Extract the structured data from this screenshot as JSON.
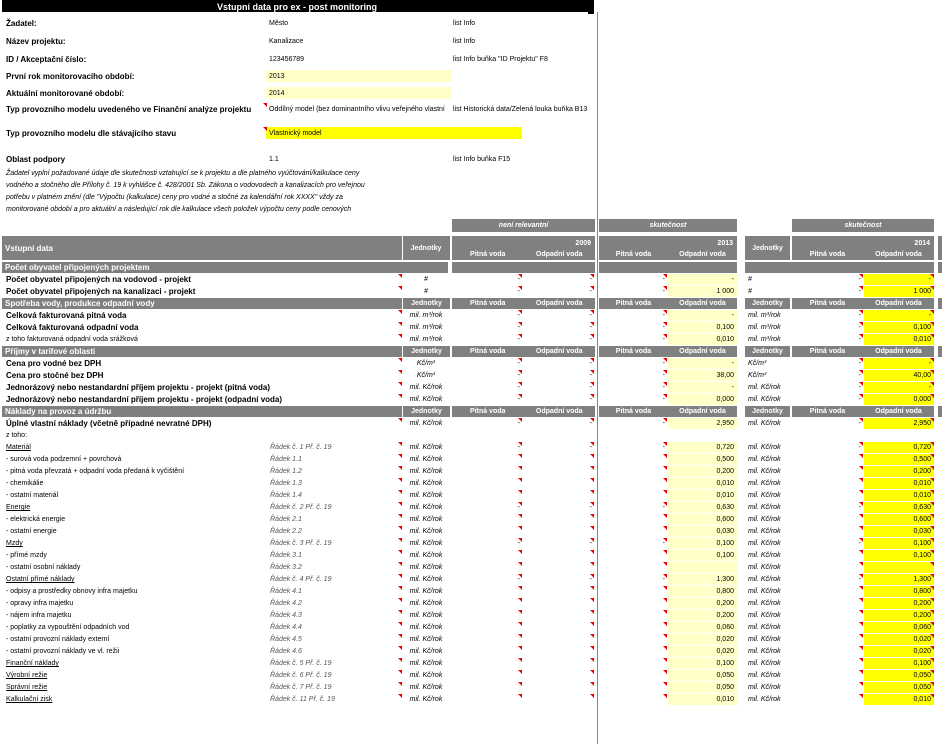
{
  "title": "Vstupní data pro ex - post monitoring",
  "info": [
    {
      "label": "Žadatel:",
      "value": "Město",
      "note": "list Info"
    },
    {
      "label": "Název projektu:",
      "value": "Kanalizace",
      "note": "list Info"
    },
    {
      "label": "ID / Akceptační číslo:",
      "value": "123456789",
      "note": "list Info buňka \"ID Projektu\" F8"
    },
    {
      "label": "První rok monitorovacího období:",
      "value": "2013",
      "note": ""
    },
    {
      "label": "Aktuální monitorované období:",
      "value": "2014",
      "note": ""
    },
    {
      "label": "Typ provozního modelu uvedeného ve Finanční analýze projektu",
      "value": "Oddílný model (bez dominantního vlivu veřejného vlastní",
      "note": "list Historická data/Zelená louka buňka B13"
    },
    {
      "label": "Typ provozního modelu dle stávajícího stavu",
      "value": "Vlastnický model",
      "note": ""
    },
    {
      "label": "Oblast podpory",
      "value": "1.1",
      "note": "list Info buňka F15"
    }
  ],
  "instruction": [
    "Žadatel vyplní požadované údaje dle skutečnosti vztahující se k projektu a dle platného vyúčtování/kalkulace ceny",
    "vodného a stočného dle Přílohy č. 19 k vyhlášce č. 428/2001 Sb. Zákona o vodovodech a kanalizacích pro veřejnou",
    "potřebu v platném znění (dle \"Výpočtu (kalkulace) ceny pro vodné a stočné za kalendářní rok XXXX\" vždy za",
    "monitorované období a pro aktuální a následující rok dle kalkulace všech položek výpočtu ceny podle cenových"
  ],
  "col_hdr": {
    "not_relevant": "není relevantní",
    "reality1": "skutečnost",
    "reality2": "skutečnost",
    "y1": "2009",
    "y2": "2013",
    "y3": "2014",
    "vstupni": "Vstupní data",
    "jednotky": "Jednotky",
    "pitna": "Pitná voda",
    "odpadni": "Odpadní voda"
  },
  "rows": [
    {
      "t": "sec",
      "label": "Počet obyvatel připojených projektem"
    },
    {
      "label": "Počet obyvatel připojených na vodovod - projekt",
      "b": 1,
      "unit": "#",
      "c": [
        "-",
        "-",
        "-",
        "-",
        "-",
        "-"
      ]
    },
    {
      "label": "Počet obyvatel připojených na kanalizaci - projekt",
      "b": 1,
      "unit": "#",
      "c": [
        "-",
        "-",
        "-",
        "1 000",
        "-",
        "1 000"
      ]
    },
    {
      "t": "sec",
      "label": "Spotřeba vody, produkce odpadní vody",
      "hdr": 1
    },
    {
      "label": "Celková fakturovaná pitná voda",
      "b": 1,
      "unit": "mil. m³/rok",
      "c": [
        "-",
        "-",
        "-",
        "-",
        "-",
        "-"
      ]
    },
    {
      "label": "Celková fakturovaná odpadní voda",
      "b": 1,
      "unit": "mil. m³/rok",
      "c": [
        "-",
        "-",
        "-",
        "0,100",
        "-",
        "0,100"
      ]
    },
    {
      "label": "z toho fakturovaná odpadní voda srážková",
      "unit": "mil. m³/rok",
      "c": [
        "-",
        "-",
        "-",
        "0,010",
        "-",
        "0,010"
      ]
    },
    {
      "t": "sec",
      "label": "Příjmy v tarifové oblasti",
      "hdr": 1
    },
    {
      "label": "Cena pro vodné bez DPH",
      "b": 1,
      "unit": "Kč/m³",
      "c": [
        "-",
        "-",
        "-",
        "-",
        "-",
        "-"
      ]
    },
    {
      "label": "Cena pro stočné bez DPH",
      "b": 1,
      "unit": "Kč/m³",
      "c": [
        "-",
        "-",
        "-",
        "38,00",
        "-",
        "40,00"
      ]
    },
    {
      "label": "Jednorázový nebo nestandardní příjem projektu - projekt (pitná voda)",
      "b": 1,
      "unit": "mil. Kč/rok",
      "c": [
        "-",
        "-",
        "-",
        "-",
        "-",
        "-"
      ]
    },
    {
      "label": "Jednorázový nebo nestandardní příjem projektu - projekt (odpadní voda)",
      "b": 1,
      "unit": "mil. Kč/rok",
      "c": [
        "-",
        "-",
        "-",
        "0,000",
        "-",
        "0,000"
      ]
    },
    {
      "t": "sec",
      "label": "Náklady na provoz a údržbu",
      "hdr": 1
    },
    {
      "label": "Úplné vlastní náklady (včetně případné nevratné DPH)",
      "b": 1,
      "unit": "mil. Kč/rok",
      "c": [
        "-",
        "-",
        "-",
        "2,950",
        "-",
        "2,950"
      ]
    },
    {
      "label": "z toho:",
      "c": null
    },
    {
      "label": "Materiál",
      "u": 1,
      "ref": "Řádek č. 1 Př. č. 19",
      "unit": "mil. Kč/rok",
      "c": [
        "-",
        "-",
        "-",
        "0,720",
        "-",
        "0,720"
      ]
    },
    {
      "label": " - surová voda podzemní + povrchová",
      "ref": "Řádek 1.1",
      "unit": "mil. Kč/rok",
      "c": [
        "",
        "",
        "",
        "0,500",
        "",
        "0,500"
      ]
    },
    {
      "label": " - pitná voda převzatá + odpadní voda     předaná k vyčištění",
      "ref": "Řádek 1.2",
      "unit": "mil. Kč/rok",
      "c": [
        "",
        "",
        "",
        "0,200",
        "",
        "0,200"
      ]
    },
    {
      "label": " - chemikálie",
      "ref": "Řádek 1.3",
      "unit": "mil. Kč/rok",
      "c": [
        "",
        "",
        "",
        "0,010",
        "",
        "0,010"
      ]
    },
    {
      "label": " - ostatní materiál",
      "ref": "Řádek 1.4",
      "unit": "mil. Kč/rok",
      "c": [
        "",
        "",
        "",
        "0,010",
        "",
        "0,010"
      ]
    },
    {
      "label": "Energie",
      "u": 1,
      "ref": "Řádek č. 2 Př. č. 19",
      "unit": "mil. Kč/rok",
      "c": [
        "-",
        "-",
        "-",
        "0,630",
        "-",
        "0,630"
      ]
    },
    {
      "label": " - elektrická energie",
      "ref": "Řádek 2.1",
      "unit": "mil. Kč/rok",
      "c": [
        "",
        "",
        "",
        "0,600",
        "",
        "0,600"
      ]
    },
    {
      "label": " - ostatní energie",
      "ref": "Řádek 2.2",
      "unit": "mil. Kč/rok",
      "c": [
        "",
        "",
        "",
        "0,030",
        "",
        "0,030"
      ]
    },
    {
      "label": "Mzdy",
      "u": 1,
      "ref": "Řádek č. 3 Př. č. 19",
      "unit": "mil. Kč/rok",
      "c": [
        "-",
        "-",
        "-",
        "0,100",
        "-",
        "0,100"
      ]
    },
    {
      "label": " - přímé mzdy",
      "ref": "Řádek 3.1",
      "unit": "mil. Kč/rok",
      "c": [
        "",
        "",
        "",
        "0,100",
        "",
        "0,100"
      ]
    },
    {
      "label": " - ostatní osobní náklady",
      "ref": "Řádek 3.2",
      "unit": "mil. Kč/rok",
      "c": [
        "",
        "",
        "",
        "",
        "",
        ""
      ]
    },
    {
      "label": "Ostatní přímé náklady",
      "u": 1,
      "ref": "Řádek č. 4 Př. č. 19",
      "unit": "mil. Kč/rok",
      "c": [
        "-",
        "-",
        "-",
        "1,300",
        "-",
        "1,300"
      ]
    },
    {
      "label": " - odpisy a prostředky obnovy infra majetku",
      "ref": "Řádek 4.1",
      "unit": "mil. Kč/rok",
      "c": [
        "",
        "",
        "",
        "0,800",
        "",
        "0,800"
      ]
    },
    {
      "label": " - opravy infra majetku",
      "ref": "Řádek 4.2",
      "unit": "mil. Kč/rok",
      "c": [
        "",
        "",
        "",
        "0,200",
        "",
        "0,200"
      ]
    },
    {
      "label": " - nájem infra majetku",
      "ref": "Řádek 4.3",
      "unit": "mil. Kč/rok",
      "c": [
        "",
        "",
        "",
        "0,200",
        "",
        "0,200"
      ]
    },
    {
      "label": " - poplatky za vypouštění odpadních vod",
      "ref": "Řádek 4.4",
      "unit": "mil. Kč/rok",
      "c": [
        "",
        "",
        "",
        "0,060",
        "",
        "0,060"
      ]
    },
    {
      "label": " - ostatní provozní náklady externí",
      "ref": "Řádek 4.5",
      "unit": "mil. Kč/rok",
      "c": [
        "",
        "",
        "",
        "0,020",
        "",
        "0,020"
      ]
    },
    {
      "label": " - ostatní provozní náklady ve vl. režii",
      "ref": "Řádek 4.6",
      "unit": "mil. Kč/rok",
      "c": [
        "",
        "",
        "",
        "0,020",
        "",
        "0,020"
      ]
    },
    {
      "label": "Finanční náklady",
      "u": 1,
      "ref": "Řádek č. 5 Př. č. 19",
      "unit": "mil. Kč/rok",
      "c": [
        "",
        "",
        "",
        "0,100",
        "",
        "0,100"
      ]
    },
    {
      "label": "Výrobní režie",
      "u": 1,
      "ref": "Řádek č. 6 Př. č. 19",
      "unit": "mil. Kč/rok",
      "c": [
        "",
        "",
        "",
        "0,050",
        "",
        "0,050"
      ]
    },
    {
      "label": "Správní režie",
      "u": 1,
      "ref": "Řádek č. 7 Př. č. 19",
      "unit": "mil. Kč/rok",
      "c": [
        "",
        "",
        "",
        "0,050",
        "",
        "0,050"
      ]
    },
    {
      "label": "Kalkulační zisk",
      "u": 1,
      "ref": "Řádek č. 11 Př. č. 19",
      "unit": "mil. Kč/rok",
      "c": [
        "",
        "",
        "",
        "0,010",
        "",
        "0,010"
      ]
    }
  ]
}
